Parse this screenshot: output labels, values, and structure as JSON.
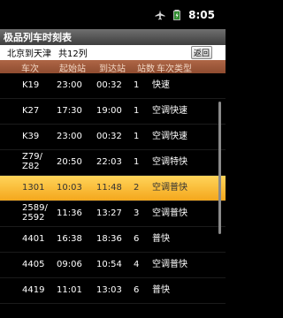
{
  "status_bar": {
    "time": "8:05",
    "icons": [
      "airplane-icon",
      "battery-icon"
    ]
  },
  "app": {
    "title": "极品列车时刻表"
  },
  "route": {
    "text": "北京到天津",
    "count": "共12列",
    "back_label": "返回"
  },
  "columns": {
    "train": "车次",
    "departure": "起始站",
    "arrival": "到达站",
    "stops": "站数",
    "type": "车次类型"
  },
  "rows": [
    {
      "train": "K19",
      "departure": "23:00",
      "arrival": "00:32",
      "stops": "1",
      "type": "快速"
    },
    {
      "train": "K27",
      "departure": "17:30",
      "arrival": "19:00",
      "stops": "1",
      "type": "空调快速"
    },
    {
      "train": "K39",
      "departure": "23:00",
      "arrival": "00:32",
      "stops": "1",
      "type": "空调快速"
    },
    {
      "train": "Z79/Z82",
      "train_line1": "Z79/",
      "train_line2": "Z82",
      "departure": "20:50",
      "arrival": "22:03",
      "stops": "1",
      "type": "空调特快"
    },
    {
      "train": "1301",
      "departure": "10:03",
      "arrival": "11:48",
      "stops": "2",
      "type": "空调普快",
      "selected": true
    },
    {
      "train": "2589/2592",
      "train_line1": "2589/",
      "train_line2": "2592",
      "departure": "11:36",
      "arrival": "13:27",
      "stops": "3",
      "type": "空调普快"
    },
    {
      "train": "4401",
      "departure": "16:38",
      "arrival": "18:36",
      "stops": "6",
      "type": "普快"
    },
    {
      "train": "4405",
      "departure": "09:06",
      "arrival": "10:54",
      "stops": "4",
      "type": "空调普快"
    },
    {
      "train": "4419",
      "departure": "11:01",
      "arrival": "13:03",
      "stops": "6",
      "type": "普快"
    }
  ],
  "colors": {
    "header_bg": "#9e5a3c",
    "selected_row": "#f9be3a",
    "title_bar": "#555555"
  }
}
